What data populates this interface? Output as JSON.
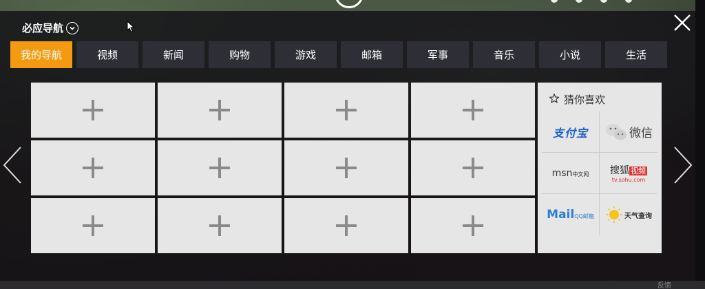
{
  "header": {
    "title": "必应导航"
  },
  "tabs": [
    {
      "label": "我的导航",
      "active": true
    },
    {
      "label": "视频"
    },
    {
      "label": "新闻"
    },
    {
      "label": "购物"
    },
    {
      "label": "游戏"
    },
    {
      "label": "邮箱"
    },
    {
      "label": "军事"
    },
    {
      "label": "音乐"
    },
    {
      "label": "小说"
    },
    {
      "label": "生活"
    }
  ],
  "grid": {
    "rows": 3,
    "cols": 4,
    "tile_icon": "plus-icon"
  },
  "sidebar": {
    "title": "猜你喜欢",
    "icon": "star-icon",
    "items": [
      {
        "name": "支付宝",
        "icon": "alipay-logo"
      },
      {
        "name": "微信",
        "icon": "wechat-logo"
      },
      {
        "name": "msn",
        "sub": "中文网",
        "icon": "msn-logo"
      },
      {
        "name": "搜狐",
        "badge": "视频",
        "url": "tv.sohu.com",
        "icon": "sohu-video-logo"
      },
      {
        "name": "Mail",
        "sub": "QQ邮箱",
        "icon": "qq-mail-logo"
      },
      {
        "name": "天气查询",
        "icon": "weather-logo"
      }
    ]
  },
  "footer": {
    "text": "反馈"
  },
  "colors": {
    "accent": "#f39a10",
    "tab_bg": "#2e2e36",
    "tile_bg": "#e6e6e6"
  }
}
